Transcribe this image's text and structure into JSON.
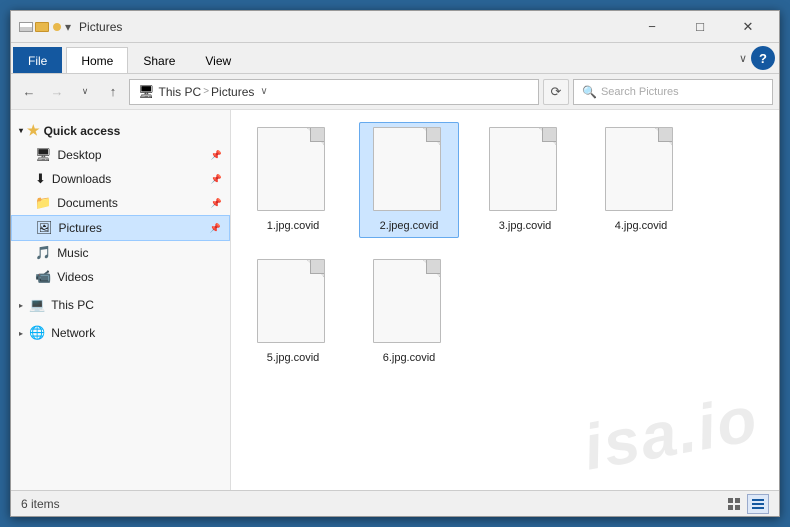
{
  "window": {
    "title": "Pictures",
    "minimize_label": "−",
    "restore_label": "□",
    "close_label": "✕"
  },
  "ribbon": {
    "file_tab": "File",
    "home_tab": "Home",
    "share_tab": "Share",
    "view_tab": "View",
    "chevron": "∨",
    "help": "?"
  },
  "addressbar": {
    "back": "←",
    "forward": "→",
    "dropdown": "∨",
    "up": "↑",
    "path_icon": "💻",
    "path_thispc": "This PC",
    "path_sep": ">",
    "path_pictures": "Pictures",
    "path_dropdown": "∨",
    "refresh": "⟳",
    "search_placeholder": "Search Pictures"
  },
  "sidebar": {
    "quick_access_label": "Quick access",
    "desktop_label": "Desktop",
    "downloads_label": "Downloads",
    "documents_label": "Documents",
    "pictures_label": "Pictures",
    "music_label": "Music",
    "videos_label": "Videos",
    "thispc_label": "This PC",
    "network_label": "Network"
  },
  "files": [
    {
      "name": "1.jpg.covid",
      "selected": false
    },
    {
      "name": "2.jpeg.covid",
      "selected": true
    },
    {
      "name": "3.jpg.covid",
      "selected": false
    },
    {
      "name": "4.jpg.covid",
      "selected": false
    },
    {
      "name": "5.jpg.covid",
      "selected": false
    },
    {
      "name": "6.jpg.covid",
      "selected": false
    }
  ],
  "status": {
    "count": "6 items"
  },
  "watermark": "isa.io"
}
